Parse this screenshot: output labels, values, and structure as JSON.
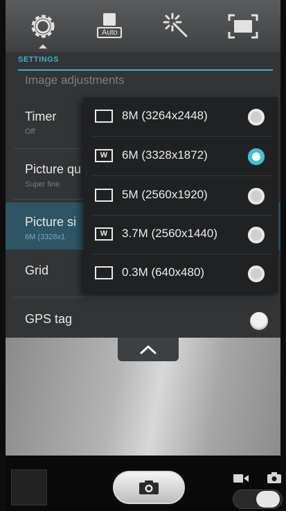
{
  "toolbar": {
    "auto_label": "Auto"
  },
  "settings": {
    "section_header": "SETTINGS",
    "ghost_label": "Image adjustments",
    "rows": [
      {
        "title": "Timer",
        "value": "Off"
      },
      {
        "title": "Picture qu",
        "value": "Super fine"
      },
      {
        "title": "Picture si",
        "value": "6M (3328x1"
      },
      {
        "title": "Grid",
        "value": ""
      },
      {
        "title": "GPS tag",
        "value": ""
      }
    ]
  },
  "picture_size_menu": {
    "options": [
      {
        "label": "8M (3264x2448)",
        "wide": false,
        "selected": false
      },
      {
        "label": "6M (3328x1872)",
        "wide": true,
        "selected": true
      },
      {
        "label": "5M (2560x1920)",
        "wide": false,
        "selected": false
      },
      {
        "label": "3.7M (2560x1440)",
        "wide": true,
        "selected": false
      },
      {
        "label": "0.3M (640x480)",
        "wide": false,
        "selected": false
      }
    ],
    "wide_badge": "W"
  },
  "colors": {
    "accent": "#3cc3cf",
    "panel": "#323436",
    "selected_row": "#2d5566"
  },
  "icons": {
    "settings": "gear-icon",
    "scene": "auto-mode-icon",
    "effects": "magic-wand-icon",
    "fullscreen": "frame-icon",
    "collapse": "chevron-up-icon",
    "shutter": "camera-icon",
    "video": "video-camera-icon",
    "photo": "photo-camera-icon"
  }
}
